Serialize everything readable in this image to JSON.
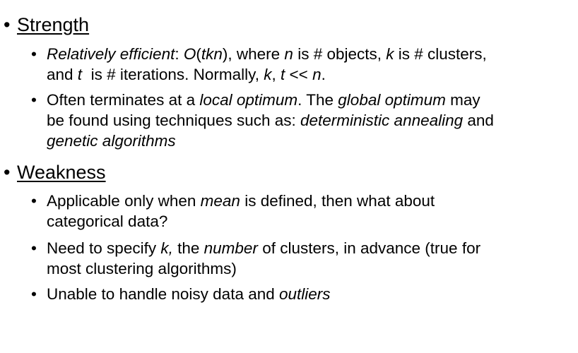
{
  "sections": [
    {
      "heading": "Strength",
      "items": [
        {
          "lines": [
            [
              {
                "t": "Relatively efficient",
                "i": true
              },
              {
                "t": ": ",
                "i": false
              },
              {
                "t": "O",
                "i": true
              },
              {
                "t": "(",
                "i": false
              },
              {
                "t": "tkn",
                "i": true
              },
              {
                "t": "), where ",
                "i": false
              },
              {
                "t": "n",
                "i": true
              },
              {
                "t": " is # objects, ",
                "i": false
              },
              {
                "t": "k",
                "i": true
              },
              {
                "t": " is # clusters,",
                "i": false
              }
            ],
            [
              {
                "t": "and ",
                "i": false
              },
              {
                "t": "t",
                "i": true
              },
              {
                "t": "  is # iterations. Normally, ",
                "i": false
              },
              {
                "t": "k",
                "i": true
              },
              {
                "t": ", ",
                "i": false
              },
              {
                "t": "t",
                "i": true
              },
              {
                "t": " << ",
                "i": false
              },
              {
                "t": "n",
                "i": true
              },
              {
                "t": ".",
                "i": false
              }
            ]
          ]
        },
        {
          "lines": [
            [
              {
                "t": "Often terminates at a ",
                "i": false
              },
              {
                "t": "local optimum",
                "i": true
              },
              {
                "t": ". The ",
                "i": false
              },
              {
                "t": "global optimum",
                "i": true
              },
              {
                "t": " may",
                "i": false
              }
            ],
            [
              {
                "t": "be found using techniques such as: ",
                "i": false
              },
              {
                "t": "deterministic annealing",
                "i": true
              },
              {
                "t": " and",
                "i": false
              }
            ],
            [
              {
                "t": "genetic algorithms",
                "i": true
              }
            ]
          ]
        }
      ]
    },
    {
      "heading": "Weakness",
      "items": [
        {
          "lines": [
            [
              {
                "t": "Applicable only when ",
                "i": false
              },
              {
                "t": "mean",
                "i": true
              },
              {
                "t": " is defined, then what about",
                "i": false
              }
            ],
            [
              {
                "t": "categorical data?",
                "i": false
              }
            ]
          ]
        },
        {
          "lines": [
            [
              {
                "t": "Need to specify ",
                "i": false
              },
              {
                "t": "k,",
                "i": true
              },
              {
                "t": " the ",
                "i": false
              },
              {
                "t": "number",
                "i": true
              },
              {
                "t": " of clusters, in advance (true for",
                "i": false
              }
            ],
            [
              {
                "t": "most clustering algorithms)",
                "i": false
              }
            ]
          ]
        },
        {
          "lines": [
            [
              {
                "t": "Unable to handle noisy data and ",
                "i": false
              },
              {
                "t": "outliers",
                "i": true
              }
            ]
          ]
        }
      ]
    }
  ]
}
